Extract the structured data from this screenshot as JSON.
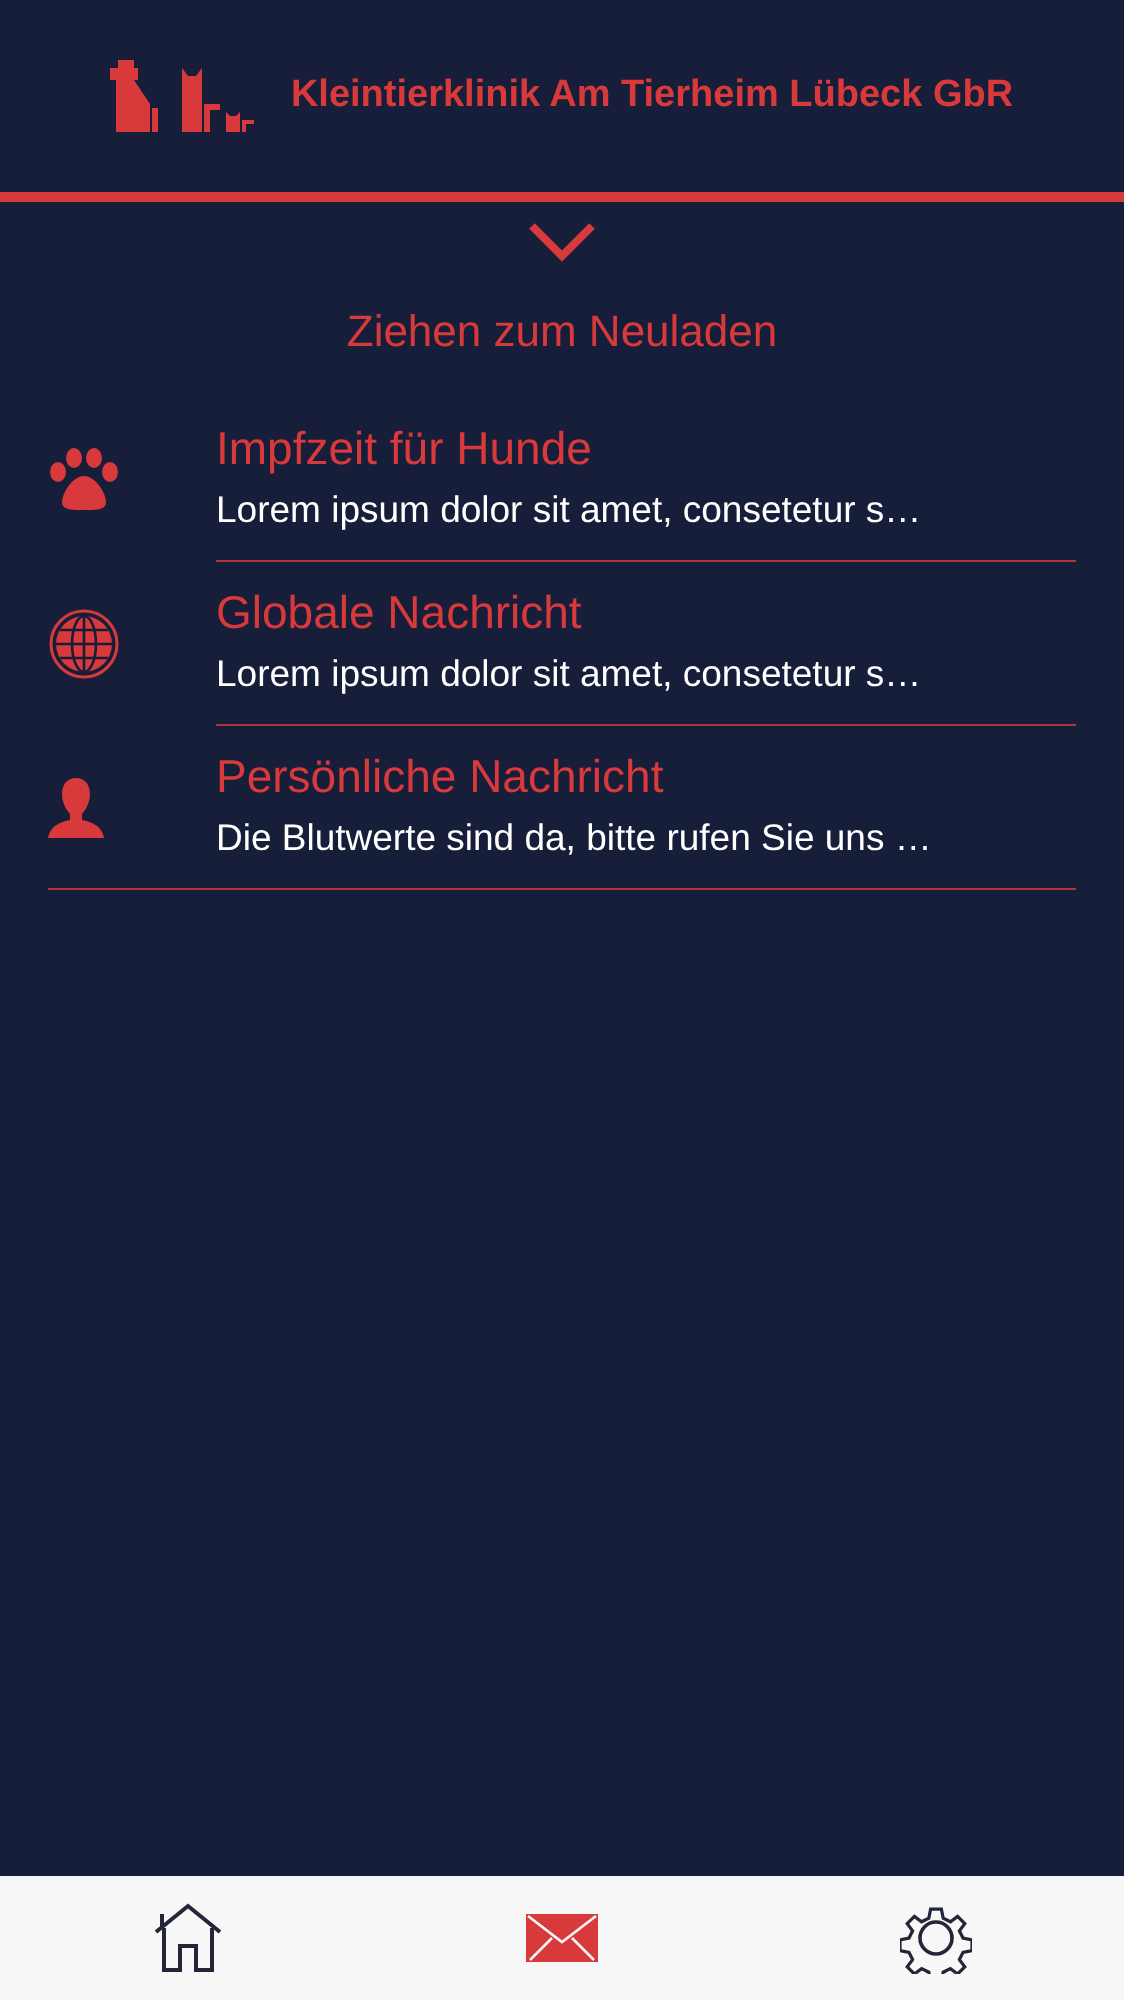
{
  "header": {
    "title": "Kleintierklinik Am Tierheim Lübeck GbR"
  },
  "pull_to_refresh": {
    "label": "Ziehen zum Neuladen"
  },
  "messages": [
    {
      "kind": "paw",
      "title": "Impfzeit für Hunde",
      "preview": "Lorem ipsum dolor sit amet, consetetur s…"
    },
    {
      "kind": "globe",
      "title": "Globale Nachricht",
      "preview": "Lorem ipsum dolor sit amet, consetetur s…"
    },
    {
      "kind": "person",
      "title": "Persönliche Nachricht",
      "preview": "Die Blutwerte sind da, bitte rufen Sie uns …"
    }
  ],
  "tab_bar": [
    {
      "kind": "home",
      "selected": false
    },
    {
      "kind": "mail",
      "selected": true
    },
    {
      "kind": "settings",
      "selected": false
    }
  ]
}
